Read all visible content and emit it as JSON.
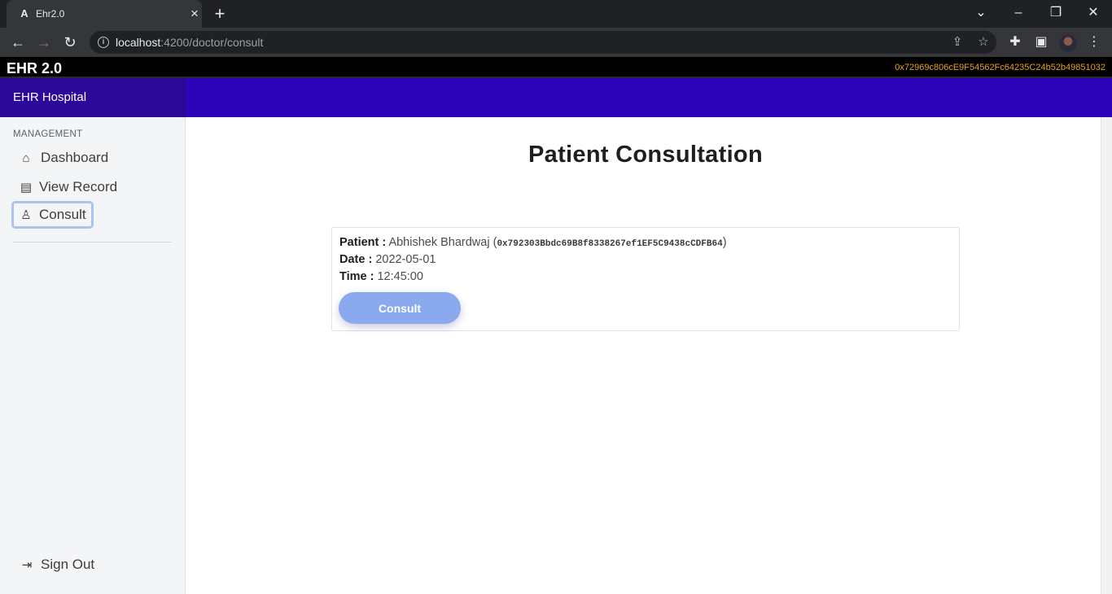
{
  "browser": {
    "tab_title": "Ehr2.0",
    "tab_favicon": "angular-icon",
    "url_host": "localhost",
    "url_rest": ":4200/doctor/consult"
  },
  "app": {
    "title": "EHR 2.0",
    "wallet_address": "0x72969c806cE9F54562Fc64235C24b52b49851032",
    "accent_color": "#2c05b8"
  },
  "sidebar": {
    "brand": "EHR Hospital",
    "section_label": "MANAGEMENT",
    "items": [
      {
        "label": "Dashboard",
        "icon": "home-icon"
      },
      {
        "label": "View Record",
        "icon": "clipboard-icon"
      },
      {
        "label": "Consult",
        "icon": "doctor-icon",
        "active": true
      }
    ],
    "signout": {
      "label": "Sign Out",
      "icon": "sign-out-icon"
    }
  },
  "main": {
    "title": "Patient Consultation",
    "appointment": {
      "patient_label": "Patient :",
      "patient_name": "Abhishek Bhardwaj",
      "patient_address": "0x792303Bbdc69B8f8338267ef1EF5C9438cCDFB64",
      "date_label": "Date :",
      "date": "2022-05-01",
      "time_label": "Time :",
      "time": "12:45:00",
      "button_label": "Consult"
    }
  }
}
